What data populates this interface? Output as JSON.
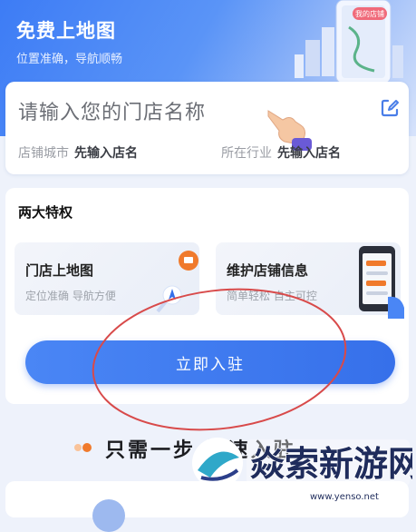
{
  "header": {
    "title": "免费上地图",
    "subtitle": "位置准确，导航顺畅",
    "badge": "我的店铺"
  },
  "store_form": {
    "name_placeholder": "请输入您的门店名称",
    "fields": [
      {
        "label": "店铺城市",
        "value": "先输入店名"
      },
      {
        "label": "所在行业",
        "value": "先输入店名"
      }
    ]
  },
  "privileges": {
    "title": "两大特权",
    "items": [
      {
        "title": "门店上地图",
        "subtitle": "定位准确 导航方便"
      },
      {
        "title": "维护店铺信息",
        "subtitle": "简单轻松 自主可控"
      }
    ],
    "cta_label": "立即入驻"
  },
  "steps": {
    "heading": "只需一步   极速入驻"
  },
  "watermark": {
    "brand": "焱索新游网",
    "url": "www.yenso.net"
  },
  "colors": {
    "brand_blue": "#3d7cf5",
    "cta_blue": "#3670ea",
    "annotation_red": "#d84a4a",
    "pin_orange": "#f07a2c",
    "text_gray": "#9a9da4"
  },
  "icons": {
    "edit": "edit-icon",
    "hand": "pointing-hand-icon",
    "pin": "map-pin-icon",
    "phone": "phone-icon",
    "city": "city-map-illustration-icon"
  }
}
